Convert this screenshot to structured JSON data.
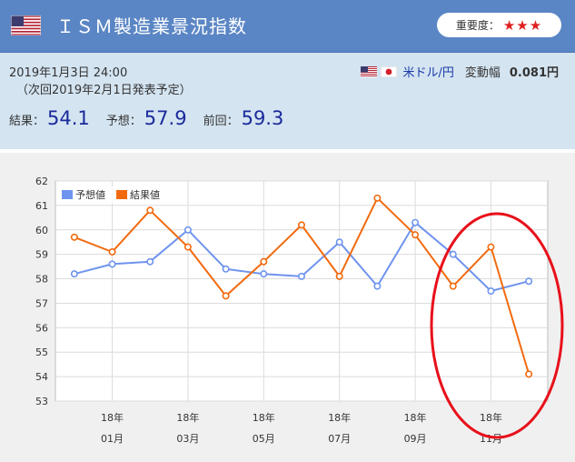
{
  "header": {
    "title": "ＩＳＭ製造業景況指数",
    "importance_label": "重要度：",
    "importance_stars": "★★★"
  },
  "info": {
    "date": "2019年1月3日 24:00",
    "next": "（次回2019年2月1日発表予定）",
    "pair": "米ドル/円",
    "volatility_label": "変動幅",
    "volatility_value": "0.081円",
    "result_label": "結果：",
    "result_value": "54.1",
    "forecast_label": "予想：",
    "forecast_value": "57.9",
    "previous_label": "前回：",
    "previous_value": "59.3"
  },
  "colors": {
    "forecast": "#6f94ee",
    "result": "#f26a10",
    "highlight_circle": "#e8101a"
  },
  "chart_data": {
    "type": "line",
    "x": [
      "2017-12",
      "2018-01",
      "2018-02",
      "2018-03",
      "2018-04",
      "2018-05",
      "2018-06",
      "2018-07",
      "2018-08",
      "2018-09",
      "2018-10",
      "2018-11",
      "2018-12"
    ],
    "tick_labels": [
      {
        "month": "2018-01",
        "line1": "18年",
        "line2": "01月"
      },
      {
        "month": "2018-03",
        "line1": "18年",
        "line2": "03月"
      },
      {
        "month": "2018-05",
        "line1": "18年",
        "line2": "05月"
      },
      {
        "month": "2018-07",
        "line1": "18年",
        "line2": "07月"
      },
      {
        "month": "2018-09",
        "line1": "18年",
        "line2": "09月"
      },
      {
        "month": "2018-11",
        "line1": "18年",
        "line2": "11月"
      }
    ],
    "series": [
      {
        "name": "予想値",
        "values": [
          58.2,
          58.6,
          58.7,
          60.0,
          58.4,
          58.2,
          58.1,
          59.5,
          57.7,
          60.3,
          59.0,
          57.5,
          57.9
        ]
      },
      {
        "name": "結果値",
        "values": [
          59.7,
          59.1,
          60.8,
          59.3,
          57.3,
          58.7,
          60.2,
          58.1,
          61.3,
          59.8,
          57.7,
          59.3,
          54.1
        ]
      }
    ],
    "ylim": [
      53,
      62
    ],
    "yticks": [
      53,
      54,
      55,
      56,
      57,
      58,
      59,
      60,
      61,
      62
    ],
    "grid": true,
    "legend_position": "top-left",
    "annotation": "red ellipse highlighting the last two months (2018-11 to 2018-12)"
  }
}
